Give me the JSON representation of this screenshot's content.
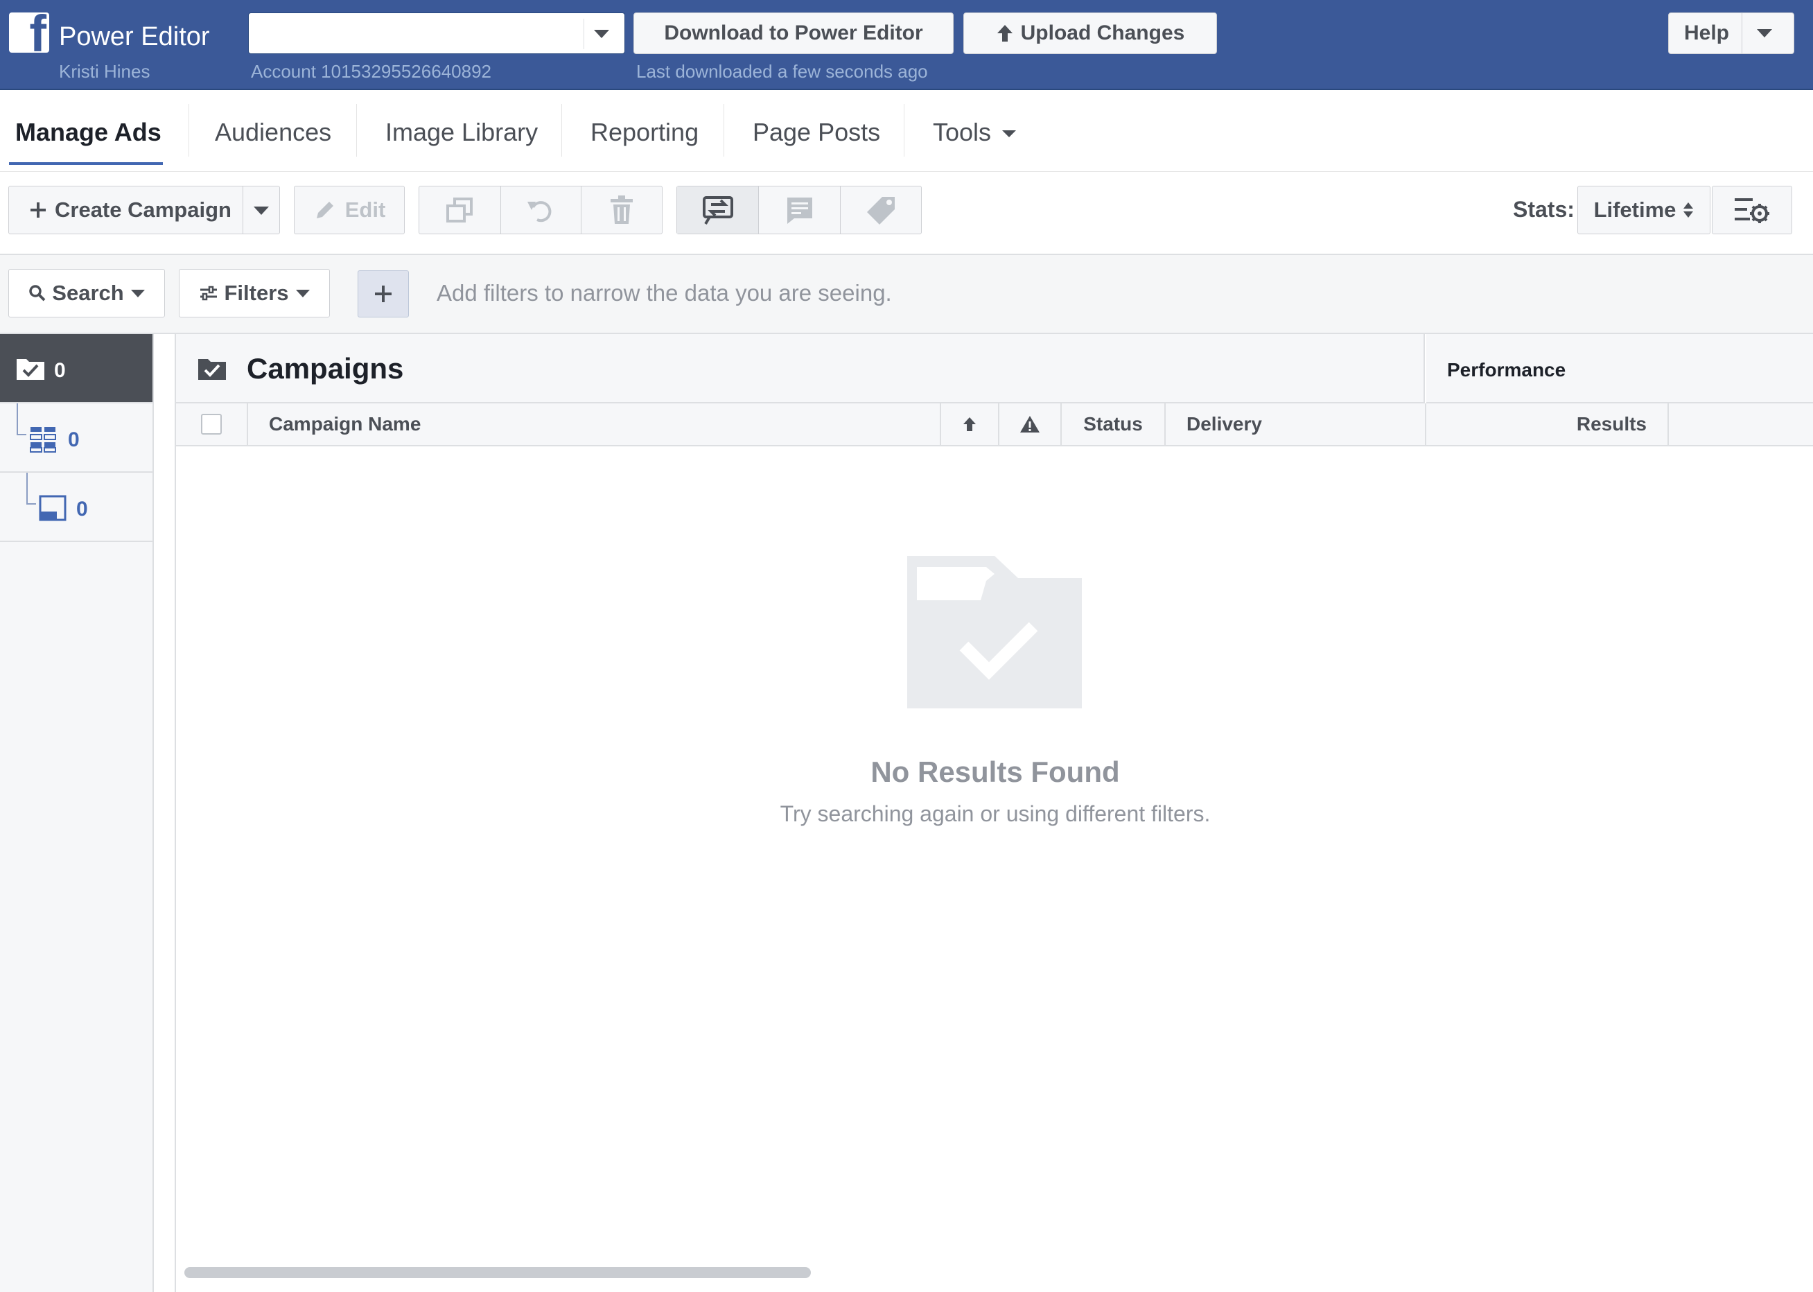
{
  "header": {
    "app_title": "Power Editor",
    "user_name": "Kristi Hines",
    "account_id": "Account 10153295526640892",
    "download_label": "Download to Power Editor",
    "upload_label": "Upload Changes",
    "last_downloaded": "Last downloaded a few seconds ago",
    "help_label": "Help"
  },
  "nav": {
    "tabs": [
      {
        "label": "Manage Ads",
        "active": true
      },
      {
        "label": "Audiences"
      },
      {
        "label": "Image Library"
      },
      {
        "label": "Reporting"
      },
      {
        "label": "Page Posts"
      },
      {
        "label": "Tools"
      }
    ]
  },
  "toolbar": {
    "create_campaign_label": "Create Campaign",
    "edit_label": "Edit",
    "stats_label": "Stats:",
    "stats_value": "Lifetime"
  },
  "filters": {
    "search_label": "Search",
    "filters_label": "Filters",
    "hint": "Add filters to narrow the data you are seeing."
  },
  "levels": {
    "campaigns_count": "0",
    "adsets_count": "0",
    "ads_count": "0"
  },
  "table": {
    "title": "Campaigns",
    "performance_title": "Performance",
    "columns": {
      "campaign_name": "Campaign Name",
      "status": "Status",
      "delivery": "Delivery",
      "results": "Results"
    }
  },
  "empty_state": {
    "title": "No Results Found",
    "subtitle": "Try searching again or using different filters."
  },
  "colors": {
    "brand_blue": "#3b5998",
    "link_blue": "#4267b2",
    "muted_gray": "#90949c"
  }
}
